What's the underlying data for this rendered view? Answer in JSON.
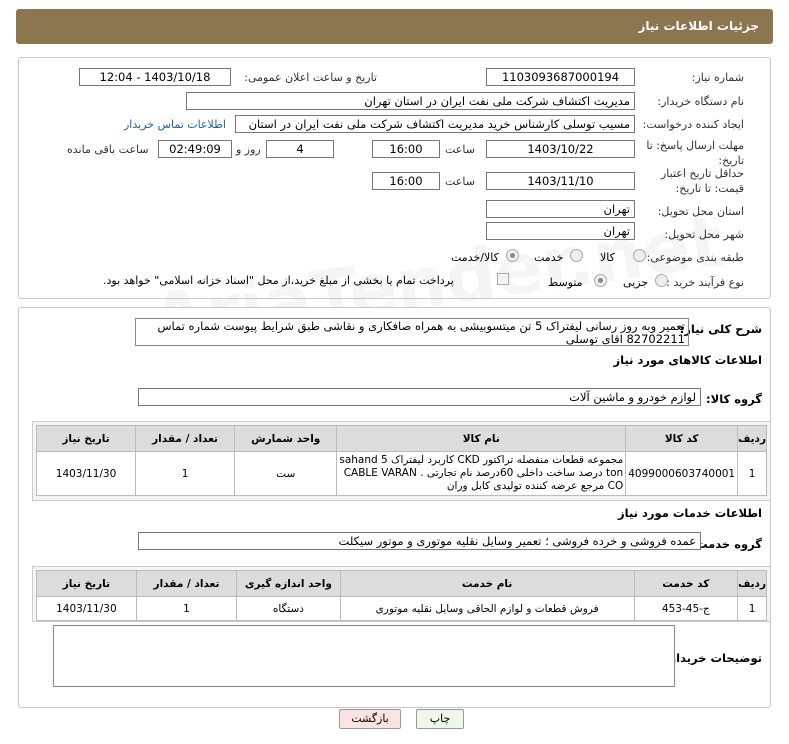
{
  "header": {
    "title": "جزئیات اطلاعات نیاز"
  },
  "form": {
    "need_number_label": "شماره نیاز:",
    "need_number": "1103093687000194",
    "announce_label": "تاریخ و ساعت اعلان عمومی:",
    "announce_value": "1403/10/18 - 12:04",
    "buyer_label": "نام دستگاه خریدار:",
    "buyer_value": "مدیریت اکتشاف شرکت ملی نفت ایران در استان تهران",
    "creator_label": "ایجاد کننده درخواست:",
    "creator_value": "مسیب توسلی کارشناس خرید مدیریت اکتشاف شرکت ملی نفت ایران در استان",
    "contact_link": "اطلاعات تماس خریدار",
    "deadline_label": "مهلت ارسال پاسخ: تا تاریخ:",
    "deadline_date": "1403/10/22",
    "time_label": "ساعت",
    "deadline_time": "16:00",
    "days_value": "4",
    "days_label": "روز و",
    "remaining_time": "02:49:09",
    "remaining_label": "ساعت باقی مانده",
    "validity_label": "حداقل تاریخ اعتبار قیمت: تا تاریخ:",
    "validity_date": "1403/11/10",
    "validity_time_label": "ساعت",
    "validity_time": "16:00",
    "province_label": "استان محل تحویل:",
    "province_value": "تهران",
    "city_label": "شهر محل تحویل:",
    "city_value": "تهران",
    "category_label": "طبقه بندی موضوعی:",
    "cat_goods": "کالا",
    "cat_service": "خدمت",
    "cat_both": "کالا/خدمت",
    "process_label": "نوع فرآیند خرید :",
    "proc_small": "جزیی",
    "proc_medium": "متوسط",
    "payment_note": "پرداخت تمام یا بخشی از مبلغ خرید،از محل \"اسناد خزانه اسلامی\" خواهد بود."
  },
  "desc": {
    "label": "شرح کلی نیاز:",
    "value": "تعمیر وبه روز رسانی  لیفتراک 5 تن میتسوبیشی به همراه صافکاری  و نقاشی طبق شرایط پیوست شماره تماس 82702211 اقای توسلی"
  },
  "goods": {
    "section": "اطلاعات کالاهای مورد نیاز",
    "group_label": "گروه کالا:",
    "group_value": "لوازم خودرو و ماشین آلات",
    "headers": [
      "ردیف",
      "کد کالا",
      "نام کالا",
      "واحد شمارش",
      "تعداد / مقدار",
      "تاریخ نیاز"
    ],
    "rows": [
      {
        "row": "1",
        "code": "4099000603740001",
        "name": "مجموعه قطعات منفصله تراکتور CKD کاربرد لیفتراک sahand 5 ton درصد ساخت داخلی 60درصد نام تجارتی . CABLE VARAN CO مرجع عرضه کننده تولیدی کابل وران",
        "unit": "ست",
        "qty": "1",
        "date": "1403/11/30"
      }
    ]
  },
  "services": {
    "section": "اطلاعات خدمات مورد نیاز",
    "group_label": "گروه خدمت:",
    "group_value": "عمده فروشی و خرده فروشی ؛ تعمیر وسایل نقلیه موتوری و موتور سیکلت",
    "headers": [
      "ردیف",
      "کد خدمت",
      "نام خدمت",
      "واحد اندازه گیری",
      "تعداد / مقدار",
      "تاریخ نیاز"
    ],
    "rows": [
      {
        "row": "1",
        "code": "ج-45-453",
        "name": "فروش قطعات و لوازم الحاقی وسایل نقلیه موتوری",
        "unit": "دستگاه",
        "qty": "1",
        "date": "1403/11/30"
      }
    ]
  },
  "buyer_notes": {
    "label": "توضیحات خریدار:",
    "value": ""
  },
  "buttons": {
    "print": "چاپ",
    "back": "بازگشت"
  },
  "watermark": "AriaTender.net"
}
